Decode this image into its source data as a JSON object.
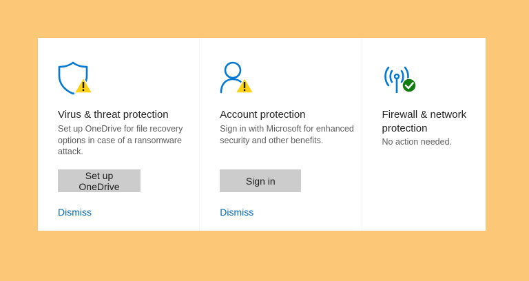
{
  "cards": [
    {
      "icon": "shield-warning-icon",
      "title": "Virus & threat protection",
      "description": "Set up OneDrive for file recovery options in case of a ransomware attack.",
      "button_label": "Set up OneDrive",
      "dismiss_label": "Dismiss"
    },
    {
      "icon": "person-warning-icon",
      "title": "Account protection",
      "description": "Sign in with Microsoft for enhanced security and other benefits.",
      "button_label": "Sign in",
      "dismiss_label": "Dismiss"
    },
    {
      "icon": "network-ok-icon",
      "title": "Firewall & network protection",
      "description": "No action needed."
    }
  ],
  "colors": {
    "background": "#fcc777",
    "accent": "#0078d4",
    "warning": "#fcd116",
    "ok": "#107c10",
    "button": "#cccccc"
  }
}
